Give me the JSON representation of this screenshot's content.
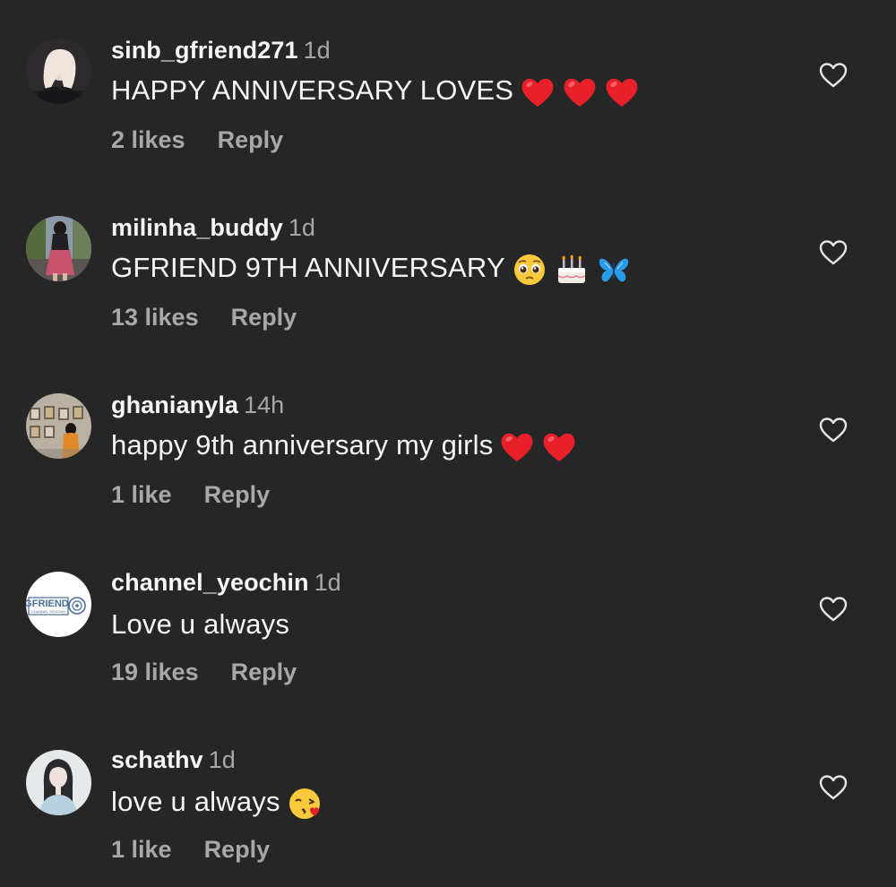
{
  "comments": [
    {
      "username": "sinb_gfriend271",
      "time": "1d",
      "text": "HAPPY ANNIVERSARY LOVES",
      "emojis": [
        "red-heart-emoji",
        "red-heart-emoji",
        "red-heart-emoji"
      ],
      "likes": "2 likes",
      "reply": "Reply",
      "avatar": "blonde-woman-avatar"
    },
    {
      "username": "milinha_buddy",
      "time": "1d",
      "text": "GFRIEND 9TH ANNIVERSARY",
      "emojis": [
        "pleading-face-emoji",
        "birthday-cake-emoji",
        "butterfly-emoji"
      ],
      "likes": "13 likes",
      "reply": "Reply",
      "avatar": "girl-in-street-avatar"
    },
    {
      "username": "ghanianyla",
      "time": "14h",
      "text": "happy 9th anniversary my girls",
      "emojis": [
        "red-heart-emoji",
        "red-heart-emoji"
      ],
      "likes": "1 like",
      "reply": "Reply",
      "avatar": "gallery-visitor-avatar"
    },
    {
      "username": "channel_yeochin",
      "time": "1d",
      "text": "Love u always",
      "emojis": [],
      "likes": "19 likes",
      "reply": "Reply",
      "avatar": "gfriend-channel-logo-avatar",
      "logo_text": "GFRIEND",
      "logo_subtext": "CHANNEL YEOCHIN"
    },
    {
      "username": "schathv",
      "time": "1d",
      "text": "love u always",
      "emojis": [
        "face-blowing-kiss-emoji"
      ],
      "likes": "1 like",
      "reply": "Reply",
      "avatar": "dark-hair-girl-avatar"
    }
  ],
  "colors": {
    "background": "#262626",
    "primary_text": "#f5f5f5",
    "secondary_text": "#a8a8a8",
    "heart_red": "#e8202a"
  }
}
